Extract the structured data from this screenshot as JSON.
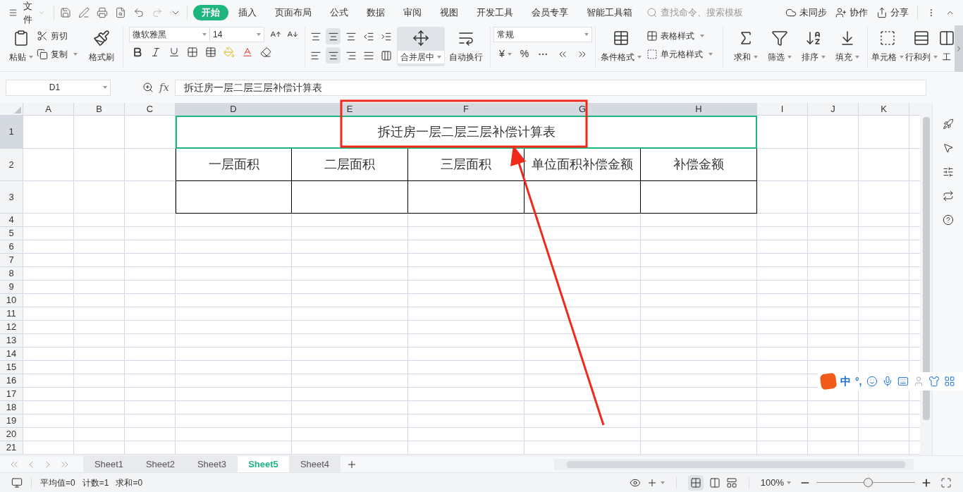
{
  "menu": {
    "file": "文件",
    "tabs": [
      {
        "label": "开始",
        "selected": true
      },
      {
        "label": "插入",
        "selected": false
      },
      {
        "label": "页面布局",
        "selected": false
      },
      {
        "label": "公式",
        "selected": false
      },
      {
        "label": "数据",
        "selected": false
      },
      {
        "label": "审阅",
        "selected": false
      },
      {
        "label": "视图",
        "selected": false
      },
      {
        "label": "开发工具",
        "selected": false
      },
      {
        "label": "会员专享",
        "selected": false
      },
      {
        "label": "智能工具箱",
        "selected": false
      }
    ],
    "search": {
      "placeholder": "查找命令、搜索模板"
    },
    "actions": [
      "未同步",
      "协作",
      "分享"
    ]
  },
  "ribbon": {
    "paste": "粘贴",
    "cut": "剪切",
    "copy": "复制",
    "format_painter": "格式刷",
    "font_name": "微软雅黑",
    "font_size": "14",
    "merge": "合并居中",
    "wrap": "自动换行",
    "number_format": "常规",
    "currency": "¥",
    "percent": "%",
    "table_style": "表格样式",
    "cell_style": "单元格样式",
    "conditional": "条件格式",
    "tools": [
      "求和",
      "筛选",
      "排序",
      "填充",
      "单元格",
      "行和列",
      "工"
    ]
  },
  "formula_bar": {
    "name_box": "D1",
    "fx": "fx",
    "value": "拆迁房一层二层三层补偿计算表"
  },
  "columns": [
    {
      "label": "A",
      "selected": false
    },
    {
      "label": "B",
      "selected": false
    },
    {
      "label": "C",
      "selected": false
    },
    {
      "label": "D",
      "selected": true
    },
    {
      "label": "E",
      "selected": true
    },
    {
      "label": "F",
      "selected": true
    },
    {
      "label": "G",
      "selected": true
    },
    {
      "label": "H",
      "selected": true
    },
    {
      "label": "I",
      "selected": false
    },
    {
      "label": "J",
      "selected": false
    },
    {
      "label": "K",
      "selected": false
    }
  ],
  "rows": [
    {
      "label": "1",
      "selected": true
    },
    {
      "label": "2",
      "selected": false
    },
    {
      "label": "3",
      "selected": false
    },
    {
      "label": "4",
      "selected": false
    },
    {
      "label": "5",
      "selected": false
    },
    {
      "label": "6",
      "selected": false
    },
    {
      "label": "7",
      "selected": false
    },
    {
      "label": "8",
      "selected": false
    },
    {
      "label": "9",
      "selected": false
    },
    {
      "label": "10",
      "selected": false
    },
    {
      "label": "11",
      "selected": false
    },
    {
      "label": "12",
      "selected": false
    },
    {
      "label": "13",
      "selected": false
    },
    {
      "label": "14",
      "selected": false
    },
    {
      "label": "15",
      "selected": false
    },
    {
      "label": "16",
      "selected": false
    },
    {
      "label": "17",
      "selected": false
    },
    {
      "label": "18",
      "selected": false
    },
    {
      "label": "19",
      "selected": false
    },
    {
      "label": "20",
      "selected": false
    },
    {
      "label": "21",
      "selected": false
    }
  ],
  "table": {
    "title": "拆迁房一层二层三层补偿计算表",
    "headers": [
      "一层面积",
      "二层面积",
      "三层面积",
      "单位面积补偿金额",
      "补偿金额"
    ]
  },
  "sheets": [
    {
      "label": "Sheet1",
      "selected": false
    },
    {
      "label": "Sheet2",
      "selected": false
    },
    {
      "label": "Sheet3",
      "selected": false
    },
    {
      "label": "Sheet5",
      "selected": true
    },
    {
      "label": "Sheet4",
      "selected": false
    }
  ],
  "status": {
    "stats": [
      "平均值=0",
      "计数=1",
      "求和=0"
    ],
    "zoom": "100%",
    "zoom_level": {
      "level": 0.52
    }
  },
  "ime": {
    "mode": "中",
    "punct": "°,"
  }
}
